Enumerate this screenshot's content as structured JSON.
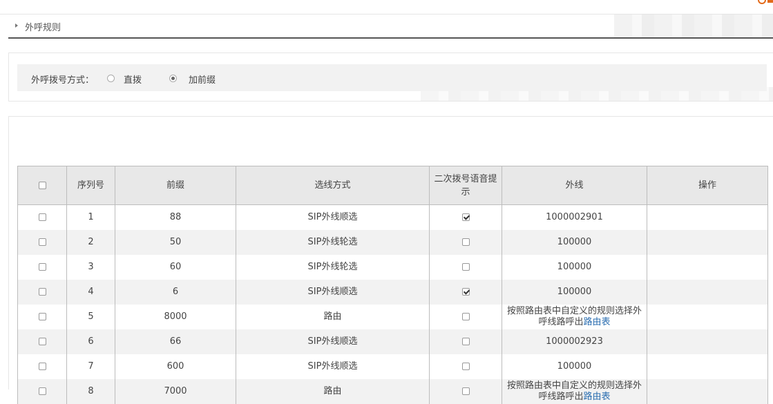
{
  "breadcrumb": {
    "title": "外呼规则"
  },
  "dial_mode": {
    "label": "外呼拨号方式：",
    "options": [
      {
        "label": "直拨",
        "selected": false
      },
      {
        "label": "加前缀",
        "selected": true
      }
    ]
  },
  "table": {
    "headers": {
      "index": "序列号",
      "prefix": "前缀",
      "select_mode": "选线方式",
      "voice_prompt": "二次拨号语音提示",
      "trunk": "外线",
      "action": "操作"
    },
    "rows": [
      {
        "index": "1",
        "prefix": "88",
        "select_mode": "SIP外线顺选",
        "voice_prompt": true,
        "trunk": "1000002901"
      },
      {
        "index": "2",
        "prefix": "50",
        "select_mode": "SIP外线轮选",
        "voice_prompt": false,
        "trunk": "100000"
      },
      {
        "index": "3",
        "prefix": "60",
        "select_mode": "SIP外线轮选",
        "voice_prompt": false,
        "trunk": "100000"
      },
      {
        "index": "4",
        "prefix": "6",
        "select_mode": "SIP外线顺选",
        "voice_prompt": true,
        "trunk": "100000"
      },
      {
        "index": "5",
        "prefix": "8000",
        "select_mode": "路由",
        "voice_prompt": false,
        "trunk": "按照路由表中自定义的规则选择外呼线路呼出",
        "trunk_link": "路由表"
      },
      {
        "index": "6",
        "prefix": "66",
        "select_mode": "SIP外线顺选",
        "voice_prompt": false,
        "trunk": "1000002923"
      },
      {
        "index": "7",
        "prefix": "600",
        "select_mode": "SIP外线顺选",
        "voice_prompt": false,
        "trunk": "100000"
      },
      {
        "index": "8",
        "prefix": "7000",
        "select_mode": "路由",
        "voice_prompt": false,
        "trunk": "按照路由表中自定义的规则选择外呼线路呼出",
        "trunk_link": "路由表"
      }
    ]
  },
  "colors": {
    "accent": "#e36a1a",
    "link": "#2a6db0",
    "header_bg": "#e8e8e8",
    "alt_row_bg": "#f2f2f2"
  }
}
